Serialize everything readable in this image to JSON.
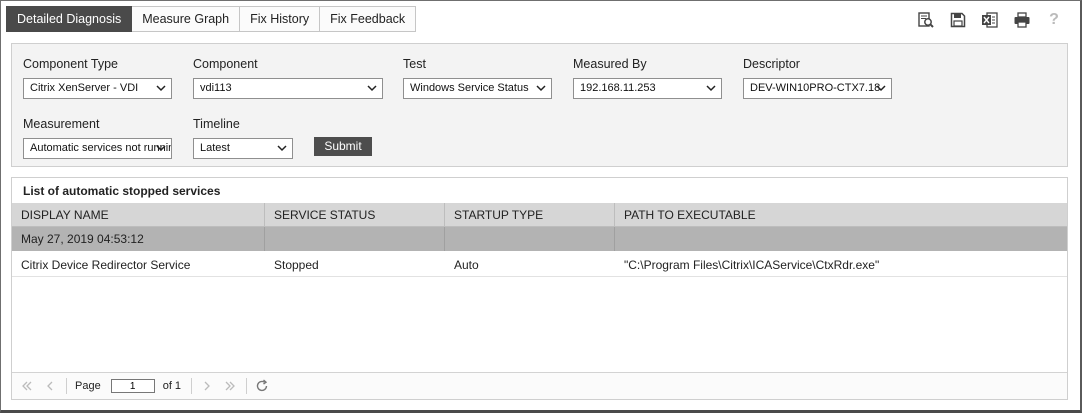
{
  "tabs": [
    {
      "label": "Detailed Diagnosis",
      "active": true
    },
    {
      "label": "Measure Graph",
      "active": false
    },
    {
      "label": "Fix History",
      "active": false
    },
    {
      "label": "Fix Feedback",
      "active": false
    }
  ],
  "toolbar": {
    "icons": [
      "search-report-icon",
      "save-icon",
      "excel-icon",
      "print-icon",
      "help-icon"
    ],
    "help_glyph": "?"
  },
  "filters": {
    "component_type": {
      "label": "Component Type",
      "value": "Citrix XenServer - VDI"
    },
    "component": {
      "label": "Component",
      "value": "vdi113"
    },
    "test": {
      "label": "Test",
      "value": "Windows Service Status"
    },
    "measured_by": {
      "label": "Measured By",
      "value": "192.168.11.253"
    },
    "descriptor": {
      "label": "Descriptor",
      "value": "DEV-WIN10PRO-CTX7.18"
    },
    "measurement": {
      "label": "Measurement",
      "value": "Automatic services not running"
    },
    "timeline": {
      "label": "Timeline",
      "value": "Latest"
    },
    "submit_label": "Submit"
  },
  "table": {
    "title": "List of automatic stopped services",
    "columns": [
      "DISPLAY NAME",
      "SERVICE STATUS",
      "STARTUP TYPE",
      "PATH TO EXECUTABLE"
    ],
    "group_label": "May 27, 2019 04:53:12",
    "rows": [
      [
        "Citrix Device Redirector Service",
        "Stopped",
        "Auto",
        "\"C:\\Program Files\\Citrix\\ICAService\\CtxRdr.exe\""
      ]
    ]
  },
  "pager": {
    "page_label": "Page",
    "page_value": "1",
    "of_label": "of 1"
  },
  "colors": {
    "active_tab": "#4a4a4a",
    "header_row": "#d6d6d6",
    "group_row": "#b3b3b3",
    "panel_bg": "#f3f3f3"
  }
}
